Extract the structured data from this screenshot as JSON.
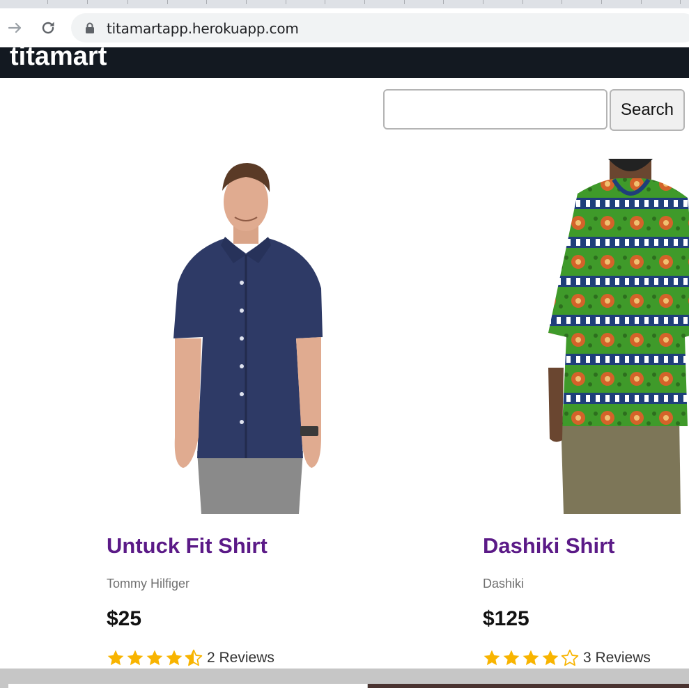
{
  "browser": {
    "url": "titamartapp.herokuapp.com",
    "icons": [
      "forward-arrow-icon",
      "reload-icon",
      "lock-icon"
    ]
  },
  "header": {
    "brand": "titamart",
    "background": "#131921"
  },
  "search": {
    "placeholder": "",
    "value": "",
    "button_label": "Search"
  },
  "products": [
    {
      "name": "Untuck Fit Shirt",
      "brand": "Tommy Hilfiger",
      "price": "$25",
      "rating": 4.5,
      "reviews": "2 Reviews",
      "image": "man in navy short-sleeve button-up shirt"
    },
    {
      "name": "Dashiki Shirt",
      "brand": "Dashiki",
      "price": "$125",
      "rating": 4,
      "reviews": "3 Reviews",
      "image": "man in green patterned dashiki shirt"
    }
  ],
  "colors": {
    "accent_link": "#5b1a87",
    "star": "#f8b400"
  }
}
